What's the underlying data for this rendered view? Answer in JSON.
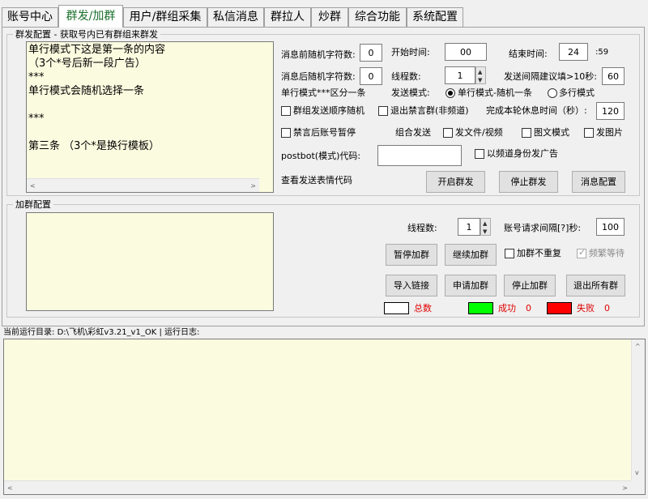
{
  "tabs": [
    "账号中心",
    "群发/加群",
    "用户/群组采集",
    "私信消息",
    "群拉人",
    "炒群",
    "综合功能",
    "系统配置"
  ],
  "mass_send": {
    "group_title": "群发配置 - 获取号内已有群组来群发",
    "content": "单行模式下这是第一条的内容\n（3个*号后新一段广告）\n***\n单行模式会随机选择一条\n\n***\n\n第三条 （3个*是换行模板）",
    "pre_random_label": "消息前随机字符数:",
    "pre_random_value": "0",
    "start_time_label": "开始时间:",
    "start_time_value": "00",
    "end_time_label": "结束时间:",
    "end_time_value": "24",
    "end_time_suffix": ":59",
    "post_random_label": "消息后随机字符数:",
    "post_random_value": "0",
    "threads_label": "线程数:",
    "threads_value": "1",
    "interval_label": "发送间隔建议填>10秒:",
    "interval_value": "60",
    "single_line_hint": "单行模式***区分一条",
    "send_mode_label": "发送模式:",
    "mode_single": "单行模式-随机一条",
    "mode_multi": "多行模式",
    "chk_random_order": "群组发送顺序随机",
    "chk_exit_banned": "退出禁言群(非频道)",
    "rest_label": "完成本轮休息时间（秒）:",
    "rest_value": "120",
    "chk_pause_banned": "禁言后账号暂停",
    "combo_send_label": "组合发送",
    "chk_file_video": "发文件/视频",
    "chk_image_text": "图文模式",
    "chk_send_image": "发图片",
    "postbot_label": "postbot(模式)代码:",
    "postbot_value": "",
    "chk_channel_fake": "以频道身份发广告",
    "emoji_code_label": "查看发送表情代码",
    "btn_start": "开启群发",
    "btn_stop": "停止群发",
    "btn_msg_config": "消息配置"
  },
  "join_group": {
    "group_title": "加群配置",
    "content": "",
    "threads_label": "线程数:",
    "threads_value": "1",
    "req_interval_label": "账号请求间隔[?]秒:",
    "req_interval_value": "100",
    "btn_pause": "暂停加群",
    "btn_continue": "继续加群",
    "chk_no_repeat": "加群不重复",
    "chk_frequent_wait": "频繁等待",
    "btn_import": "导入链接",
    "btn_apply": "申请加群",
    "btn_stop": "停止加群",
    "btn_exit_all": "退出所有群",
    "total_label": "总数",
    "success_label": "成功",
    "success_value": "0",
    "fail_label": "失败",
    "fail_value": "0",
    "total_color": "#ffffff",
    "success_color": "#00ff00",
    "fail_color": "#ff0000"
  },
  "status": {
    "dir_label": "当前运行目录:",
    "dir_value": "D:\\飞机\\彩虹v3.21_v1_OK",
    "separator": "|",
    "log_label": "运行日志:"
  },
  "log_content": ""
}
